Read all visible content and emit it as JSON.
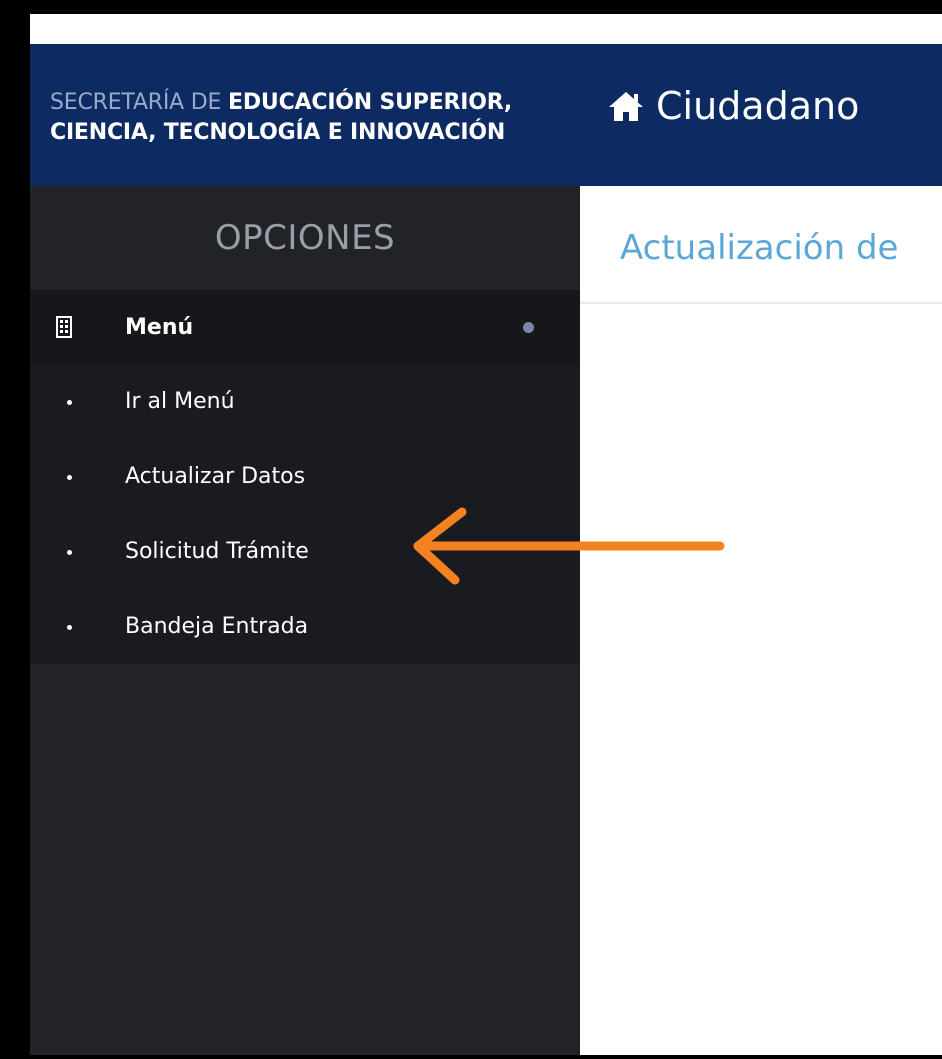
{
  "header": {
    "brand_line1_thin": "SECRETARÍA DE ",
    "brand_line1_bold": "EDUCACIÓN SUPERIOR,",
    "brand_line2": "CIENCIA, TECNOLOGÍA E INNOVACIÓN",
    "home_icon": "home-icon",
    "title": "Ciudadano"
  },
  "sidebar": {
    "heading": "OPCIONES",
    "menu": {
      "icon": "building-icon",
      "label": "Menú"
    },
    "items": [
      {
        "label": "Ir al Menú"
      },
      {
        "label": "Actualizar Datos"
      },
      {
        "label": "Solicitud Trámite"
      },
      {
        "label": "Bandeja Entrada"
      }
    ]
  },
  "content": {
    "title": "Actualización de"
  },
  "colors": {
    "header_bg": "#0d2a63",
    "sidebar_bg": "#222327",
    "title_blue": "#5aa7d8",
    "annotation_arrow": "#f58220"
  }
}
